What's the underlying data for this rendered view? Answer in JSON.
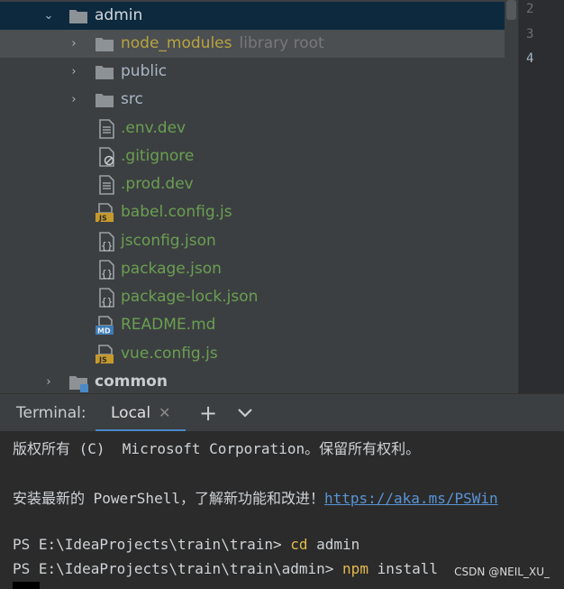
{
  "tree": {
    "items": [
      {
        "label": "admin",
        "kind": "folder",
        "expanded": true
      },
      {
        "label": "node_modules",
        "hint": "library root",
        "kind": "folder",
        "expanded": false
      },
      {
        "label": "public",
        "kind": "folder",
        "expanded": false
      },
      {
        "label": "src",
        "kind": "folder",
        "expanded": false
      },
      {
        "label": ".env.dev",
        "kind": "file-text"
      },
      {
        "label": ".gitignore",
        "kind": "file-ignore"
      },
      {
        "label": ".prod.dev",
        "kind": "file-text"
      },
      {
        "label": "babel.config.js",
        "kind": "file-js"
      },
      {
        "label": "jsconfig.json",
        "kind": "file-json"
      },
      {
        "label": "package.json",
        "kind": "file-json"
      },
      {
        "label": "package-lock.json",
        "kind": "file-json"
      },
      {
        "label": "README.md",
        "kind": "file-md"
      },
      {
        "label": "vue.config.js",
        "kind": "file-js"
      },
      {
        "label": "common",
        "kind": "module-folder",
        "expanded": false
      }
    ]
  },
  "gutter": {
    "lines": [
      "2",
      "3",
      "4"
    ]
  },
  "terminal": {
    "title": "Terminal:",
    "tab_label": "Local",
    "tab_close": "✕",
    "add_button": "+",
    "lines": {
      "copyright": "版权所有 (C)  Microsoft Corporation。保留所有权利。",
      "install_prefix": "安装最新的 PowerShell，了解新功能和改进！",
      "install_link": "https://aka.ms/PSWin",
      "prompt1": "PS E:\\IdeaProjects\\train\\train> ",
      "cmd1": "cd",
      "arg1": " admin",
      "prompt2": "PS E:\\IdeaProjects\\train\\train\\admin> ",
      "cmd2": "npm",
      "arg2": " install"
    }
  },
  "watermark": "CSDN @NEIL_XU_",
  "colors": {
    "tree_bg": "#3c3f41",
    "selection": "#4b4f52",
    "folder": "#8c9296",
    "excluded": "#b8a33f",
    "file_green": "#6a9f52",
    "accent": "#4a88c7"
  }
}
